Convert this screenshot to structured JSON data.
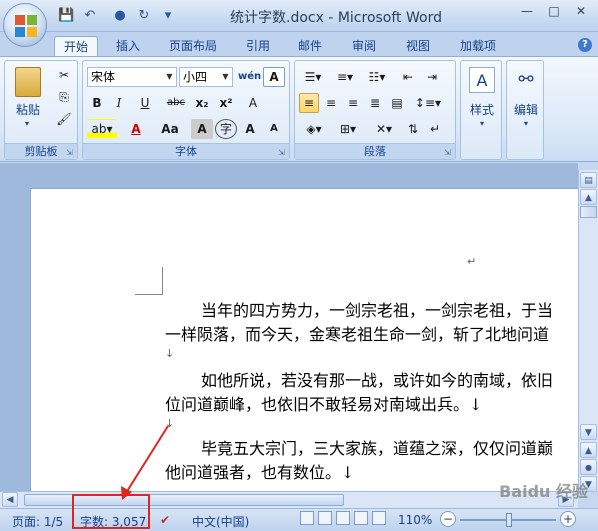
{
  "window": {
    "title": "统计字数.docx - Microsoft Word",
    "minimize": "—",
    "maximize": "□",
    "close": "✕"
  },
  "quick_access": {
    "save": "💾",
    "undo": "↶",
    "redo": "↷",
    "more": "▾"
  },
  "tabs": [
    "开始",
    "插入",
    "页面布局",
    "引用",
    "邮件",
    "审阅",
    "视图",
    "加载项"
  ],
  "active_tab": "开始",
  "ribbon": {
    "clipboard": {
      "label": "剪贴板",
      "paste": "粘贴"
    },
    "font": {
      "label": "字体",
      "font_name": "宋体",
      "font_size": "小四",
      "wen": "wén",
      "a_box": "A",
      "bold": "B",
      "italic": "I",
      "underline": "U",
      "strike": "abc",
      "subscript": "x₂",
      "superscript": "x²",
      "clear": "A",
      "font_color": "A",
      "change_case": "Aa",
      "shading": "A",
      "enclose": "字",
      "grow": "A",
      "shrink": "A"
    },
    "paragraph": {
      "label": "段落"
    },
    "styles": {
      "label": "样式"
    },
    "editing": {
      "label": "编辑"
    }
  },
  "document": {
    "paragraphs": [
      [
        "当年的四方势力，一剑宗老祖，一剑宗老祖，于当",
        "一样陨落，而今天，金寒老祖生命一剑，斩了北地问道"
      ],
      [
        "如他所说，若没有那一战，或许如今的南域，依旧",
        "位问道巅峰，也依旧不敢轻易对南域出兵。↓"
      ],
      [
        "毕竟五大宗门，三大家族，道蕴之深，仅仅问道巅",
        "他问道强者，也有数位。↓"
      ]
    ]
  },
  "status": {
    "page": "页面: 1/5",
    "words": "字数: 3,057",
    "language": "中文(中国)",
    "zoom": "110%"
  },
  "watermark": "Baidu 经验",
  "colors": {
    "highlight_red": "#e0261c",
    "accent": "#15428b"
  }
}
